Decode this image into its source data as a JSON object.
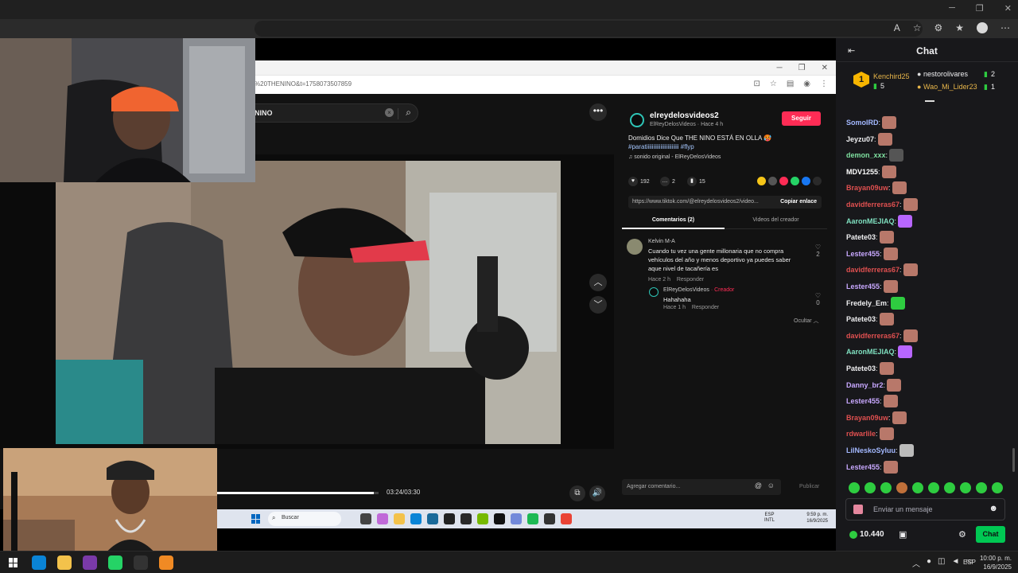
{
  "inner_browser": {
    "url": "%20THENINO&t=1758073507859"
  },
  "tiktok": {
    "search_query": "NINO",
    "clear_glyph": "×",
    "more_glyph": "•••",
    "nav_up_glyph": "︿",
    "nav_down_glyph": "﹀",
    "author": {
      "username": "elreydelosvideos2",
      "display_line": "ElReyDelosVideos · Hace 4 h",
      "follow_label": "Seguir"
    },
    "description": "Domidios Dice Que THE NINO ESTÁ EN OLLA 🥵",
    "hashtags": "#paratiiiiiiiiiiiiiiiiiiiiiii #flyp",
    "sound": "sonido original - ElReyDelosVideos",
    "stats": {
      "likes": "192",
      "comments": "2",
      "saves": "15"
    },
    "share_url": "https://www.tiktok.com/@elreydelosvideos2/video...",
    "copy_link_label": "Copiar enlace",
    "tabs": [
      "Comentarios (2)",
      "Videos del creador"
    ],
    "comments": [
      {
        "author": "Kelvin M-A",
        "text": "Cuando tu vez una gente millonaria que no compra vehículos del año y menos deportivo ya puedes saber aque nivel de tacañería es",
        "time": "Hace 2 h",
        "reply_label": "Responder",
        "likes": "2"
      }
    ],
    "reply": {
      "author": "ElReyDelosVideos",
      "creator_tag": "· Creador",
      "text": "Hahahaha",
      "time": "Hace 1 h",
      "reply_label": "Responder",
      "likes": "0"
    },
    "hide_label": "Ocultar",
    "progress": {
      "elapsed": "03:24",
      "total": "03:30",
      "label": "03:24/03:30",
      "fraction": 0.97
    },
    "add_comment_placeholder": "Agregar comentario...",
    "publish_label": "Publicar"
  },
  "inner_taskbar": {
    "search_placeholder": "Buscar",
    "lang_line1": "ESP",
    "lang_line2": "INTL",
    "time": "9:59 p. m.",
    "date": "16/9/2025"
  },
  "chat": {
    "title": "Chat",
    "leaderboard": [
      {
        "rank": "1",
        "name": "Kenchird25",
        "count": "5",
        "color": "#e8b64a"
      },
      {
        "name": "nestorolivares",
        "count": "2",
        "color": "#efeff1"
      },
      {
        "name": "Wao_Mi_Lider23",
        "count": "1",
        "color": "#e8b64a"
      }
    ],
    "messages": [
      {
        "user": "SomoIRD",
        "color": "#a3b8ff",
        "emote": "#b8786a"
      },
      {
        "user": "Jeyzu07",
        "color": "#efeff1",
        "emote": "#b8786a"
      },
      {
        "user": "demon_xxx",
        "color": "#7fe0a0",
        "emote": "#555555"
      },
      {
        "user": "MDV1255",
        "color": "#ffffff",
        "emote": "#b8786a"
      },
      {
        "user": "Brayan09uw",
        "color": "#e05050",
        "emote": "#b8786a"
      },
      {
        "user": "davidferreras67",
        "color": "#e05050",
        "emote": "#b8786a"
      },
      {
        "user": "AaronMEJIAQ",
        "color": "#7fe0c0",
        "emote": "#b866ff"
      },
      {
        "user": "Patete03",
        "color": "#efeff1",
        "emote": "#b8786a"
      },
      {
        "user": "Lester455",
        "color": "#c8a8ff",
        "emote": "#b8786a"
      },
      {
        "user": "davidferreras67",
        "color": "#e05050",
        "emote": "#b8786a"
      },
      {
        "user": "Lester455",
        "color": "#c8a8ff",
        "emote": "#b8786a"
      },
      {
        "user": "Fredely_Em",
        "color": "#efeff1",
        "emote": "#2ecc40"
      },
      {
        "user": "Patete03",
        "color": "#efeff1",
        "emote": "#b8786a"
      },
      {
        "user": "davidferreras67",
        "color": "#e05050",
        "emote": "#b8786a"
      },
      {
        "user": "AaronMEJIAQ",
        "color": "#7fe0c0",
        "emote": "#b866ff"
      },
      {
        "user": "Patete03",
        "color": "#efeff1",
        "emote": "#b8786a"
      },
      {
        "user": "Danny_br2",
        "color": "#c8a8ff",
        "emote": "#b8786a"
      },
      {
        "user": "Lester455",
        "color": "#c8a8ff",
        "emote": "#b8786a"
      },
      {
        "user": "Brayan09uw",
        "color": "#e05050",
        "emote": "#b8786a"
      },
      {
        "user": "rdwarlile",
        "color": "#e05050",
        "emote": "#b8786a"
      },
      {
        "user": "LilNeskoSyluu",
        "color": "#a3b8ff",
        "emote": "#bbbbbb"
      },
      {
        "user": "Lester455",
        "color": "#c8a8ff",
        "emote": "#b8786a"
      }
    ],
    "input_placeholder": "Enviar un mensaje",
    "points": "10.440",
    "chat_button_label": "Chat"
  },
  "host_taskbar": {
    "lang": "ESP",
    "time": "10:00 p. m.",
    "date": "16/9/2025"
  }
}
